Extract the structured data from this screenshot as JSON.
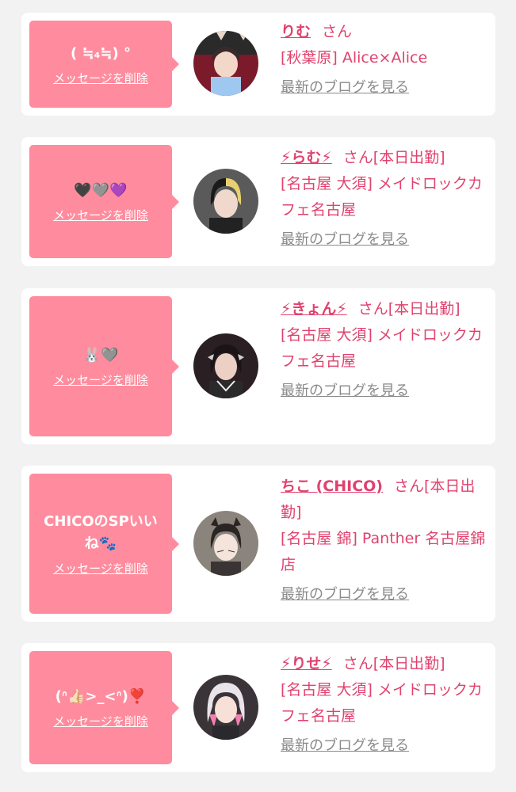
{
  "delete_label": "メッセージを削除",
  "blog_label": "最新のブログを見る",
  "cards": [
    {
      "message": "( ≒₄≒) °",
      "name": "りむ",
      "san": "さん",
      "status": "",
      "shop": "[秋葉原] Alice×Alice"
    },
    {
      "message": "🖤🩶💜",
      "name": "⚡らむ⚡",
      "san": "さん",
      "status": "[本日出勤]",
      "shop": "[名古屋 大須] メイドロックカフェ名古屋"
    },
    {
      "message": "🐰🩶",
      "name": "⚡きょん⚡",
      "san": "さん",
      "status": "[本日出勤]",
      "shop": "[名古屋 大須] メイドロックカフェ名古屋"
    },
    {
      "message": "CHICOのSPいいね🐾",
      "name": "ちこ (CHICO)",
      "san": "さん",
      "status": "[本日出勤]",
      "shop": "[名古屋 錦] Panther 名古屋錦店"
    },
    {
      "message": "(ᐢ👍🏻>_<ᐢ)❣️",
      "name": "⚡りせ⚡",
      "san": "さん",
      "status": "[本日出勤]",
      "shop": "[名古屋 大須] メイドロックカフェ名古屋"
    }
  ]
}
